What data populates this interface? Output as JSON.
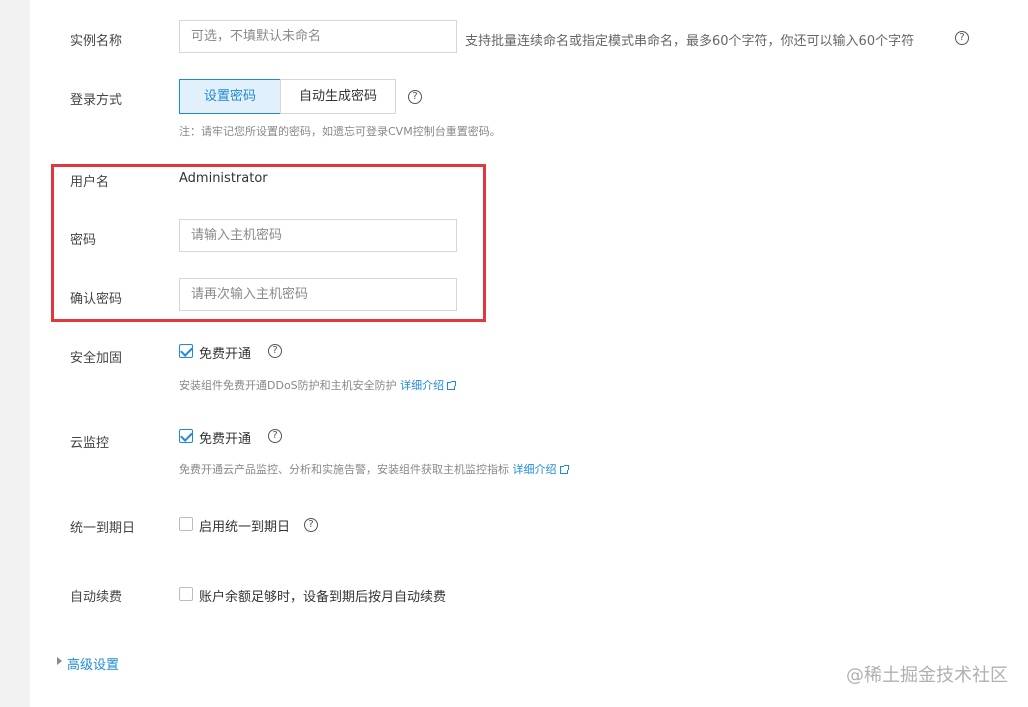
{
  "instance_name": {
    "label": "实例名称",
    "placeholder": "可选，不填默认未命名",
    "hint": "支持批量连续命名或指定模式串命名，最多60个字符，你还可以输入60个字符"
  },
  "login_method": {
    "label": "登录方式",
    "options": [
      "设置密码",
      "自动生成密码"
    ],
    "selected": "设置密码",
    "note": "注：请牢记您所设置的密码，如遗忘可登录CVM控制台重置密码。"
  },
  "username": {
    "label": "用户名",
    "value": "Administrator"
  },
  "password": {
    "label": "密码",
    "placeholder": "请输入主机密码"
  },
  "confirm_password": {
    "label": "确认密码",
    "placeholder": "请再次输入主机密码"
  },
  "security": {
    "label": "安全加固",
    "checkbox_label": "免费开通",
    "checked": true,
    "note": "安装组件免费开通DDoS防护和主机安全防护",
    "link": "详细介绍"
  },
  "monitor": {
    "label": "云监控",
    "checkbox_label": "免费开通",
    "checked": true,
    "note": "免费开通云产品监控、分析和实施告警，安装组件获取主机监控指标",
    "link": "详细介绍"
  },
  "unified_expiry": {
    "label": "统一到期日",
    "checkbox_label": "启用统一到期日",
    "checked": false
  },
  "auto_renew": {
    "label": "自动续费",
    "checkbox_label": "账户余额足够时，设备到期后按月自动续费",
    "checked": false
  },
  "advanced": {
    "label": "高级设置"
  },
  "watermark": "@稀土掘金技术社区",
  "colors": {
    "accent": "#1e8bd6",
    "highlight_border": "#e0383e",
    "active_bg": "#e1f0fb"
  },
  "icons": {
    "help": "question-circle-icon",
    "external": "external-link-icon",
    "expand": "caret-right-icon"
  }
}
